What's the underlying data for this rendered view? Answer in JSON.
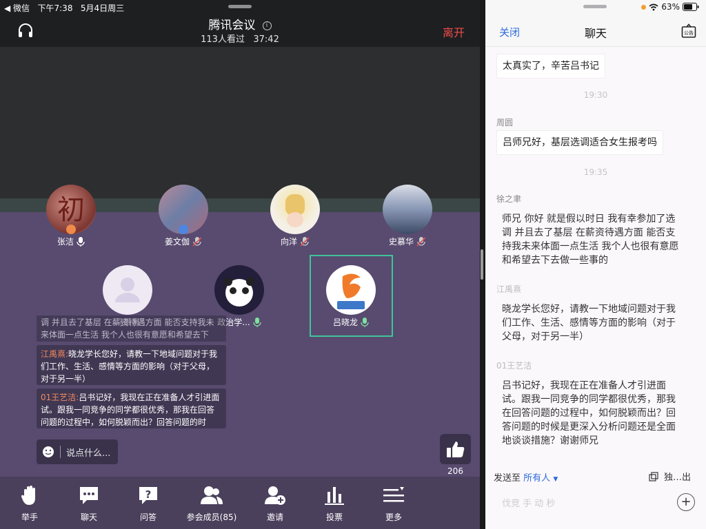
{
  "status": {
    "carrier": "◀ 微信",
    "time": "下午7:38",
    "date": "5月4日周三",
    "battery": "63%"
  },
  "meeting": {
    "title": "腾讯会议",
    "viewers": "113人看过",
    "duration": "37:42",
    "leave_label": "离开"
  },
  "participants": [
    {
      "name": "张洁",
      "avatar_color": "#8c4a4a",
      "mic": "on",
      "host": true
    },
    {
      "name": "姜文伽",
      "avatar_color": "#8a6b7a",
      "mic": "muted",
      "host": true
    },
    {
      "name": "向洋",
      "avatar_color": "#f3ecd2",
      "mic": "muted",
      "host": false
    },
    {
      "name": "史慕华",
      "avatar_color": "#6c7d99",
      "mic": "muted",
      "host": false
    },
    {
      "name": "马景熹",
      "avatar_color": "#ece7f3",
      "mic": "none",
      "host": false
    },
    {
      "name": "政治学...",
      "avatar_color": "#2a2440",
      "mic": "on",
      "host": false
    },
    {
      "name": "吕晓龙",
      "avatar_color": "#ffffff",
      "mic": "on",
      "host": false,
      "logo_text": "巴吉菜锥"
    }
  ],
  "comments": {
    "faded_text": "调 并且去了基层 在薪资待遇方面 能否支持我未来体面一点生活 我个人也很有意愿和希望去下去…",
    "items": [
      {
        "author": "江禹熹:",
        "text": "晓龙学长您好，请教一下地域问题对于我们工作、生活、感情等方面的影响（对于父母，对于另一半）"
      },
      {
        "author": "01王艺洁:",
        "text": "吕书记好，我现在正在准备人才引进面试。跟我一同竞争的同学都很优秀，那我在回答问题的过程中，如何脱颖而出？回答问题的时候…"
      }
    ],
    "input_placeholder": "说点什么..."
  },
  "likes": {
    "count": "206"
  },
  "toolbar": [
    {
      "label": "举手",
      "icon": "raise-hand-icon"
    },
    {
      "label": "聊天",
      "icon": "chat-icon"
    },
    {
      "label": "问答",
      "icon": "qa-icon"
    },
    {
      "label": "参会成员(85)",
      "icon": "members-icon"
    },
    {
      "label": "邀请",
      "icon": "invite-icon"
    },
    {
      "label": "投票",
      "icon": "vote-icon"
    },
    {
      "label": "更多",
      "icon": "more-icon"
    }
  ],
  "chat": {
    "close_label": "关闭",
    "title": "聊天",
    "messages": [
      {
        "text": "太真实了，辛苦吕书记"
      },
      {
        "timestamp": "19:30"
      },
      {
        "sender": "周圆",
        "text": "吕师兄好，基层选调适合女生报考吗"
      },
      {
        "timestamp": "19:35"
      },
      {
        "sender": "徐之聿",
        "text": "师兄 你好 就是假以时日 我有幸参加了选调 并且去了基层 在薪资待遇方面 能否支持我未来体面一点生活  我个人也很有意愿和希望去下去做一些事的"
      },
      {
        "sender": "江禹熹",
        "text": "晓龙学长您好，请教一下地域问题对于我们工作、生活、感情等方面的影响（对于父母，对于另一半）"
      },
      {
        "sender": "01王艺洁",
        "text": "吕书记好，我现在正在准备人才引进面试。跟我一同竞争的同学都很优秀，那我在回答问题的过程中，如何脱颖而出？回答问题的时候是更深入分析问题还是全面地谈谈措施？谢谢师兄"
      }
    ],
    "send_to_label": "发送至",
    "send_to_target": "所有人",
    "popout_label": "独…出",
    "input_placeholder": "伐竞 手 动 秒"
  }
}
